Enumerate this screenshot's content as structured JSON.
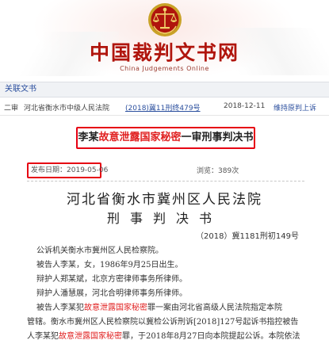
{
  "header": {
    "site_title": "中国裁判文书网",
    "site_subtitle": "China Judgements Online"
  },
  "related": {
    "heading": "关联文书",
    "row": {
      "level": "二审",
      "court": "河北省衡水市中级人民法院",
      "case_number": "(2018)冀11刑终479号",
      "date": "2018-12-11",
      "appeal": "维持原判上诉"
    }
  },
  "document": {
    "title_prefix": "李某",
    "title_highlight": "故意泄露国家秘密",
    "title_suffix": "一审刑事判决书",
    "publish_label": "发布日期：",
    "publish_date": "2019-05-06",
    "views_label": "浏览：",
    "views_count": "389次",
    "court_name": "河北省衡水市冀州区人民法院",
    "doc_type": "刑事判决书",
    "case_number": "（2018）冀1181刑初149号",
    "lines": {
      "l1": "公诉机关衡水市冀州区人民检察院。",
      "l2": "被告人李某，女，1986年9月25日出生。",
      "l3": "辩护人郑某斌，北京方密律师事务所律师。",
      "l4": "辩护人潘慧展，河北合明律师事务所律师。",
      "l5_pre": "被告人李某犯",
      "l5_hl": "故意泄露国家秘密",
      "l5_post": "罪一案由河北省高级人民法院指定本院",
      "l6": "管辖。衡水市冀州区人民检察院以冀检公诉刑诉[2018]127号起诉书指控被告",
      "l7_pre": "人李某犯",
      "l7_hl": "故意泄露国家秘密",
      "l7_post": "罪，于2018年8月27日向本院提起公诉。本院依法"
    }
  },
  "colors": {
    "brand_red": "#b0150d",
    "highlight_red": "#e02020",
    "box_red": "#e60012",
    "link_blue": "#2b4f9e"
  },
  "icons": {
    "emblem": "court-scales-emblem-icon"
  }
}
